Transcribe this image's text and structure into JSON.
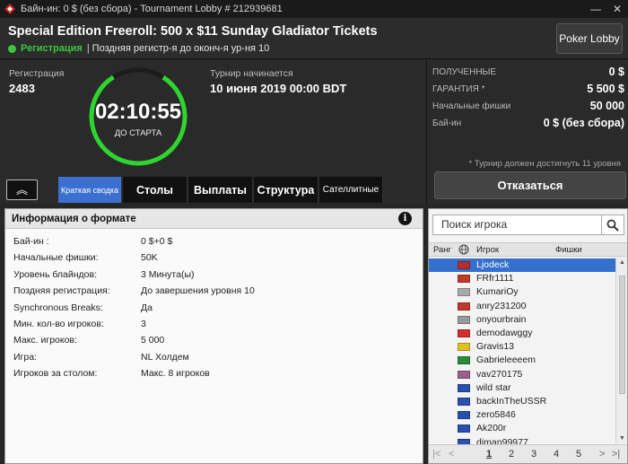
{
  "window": {
    "title": "Байн-ин: 0 $ (без сбора) - Tournament Lobby # 212939681",
    "btn_min": "—",
    "btn_close": "✕"
  },
  "header": {
    "tournament_name": "Special Edition Freeroll: 500 x $11 Sunday Gladiator Tickets",
    "status": "Регистрация",
    "status_sep": "|",
    "status_note": "Поздняя регистр-я до оконч-я ур-ня 10",
    "poker_lobby_btn": "Poker Lobby"
  },
  "info": {
    "reg_label": "Регистрация",
    "reg_value": "2483",
    "timer": "02:10:55",
    "timer_sub": "ДО СТАРТА",
    "start_label": "Турнир начинается",
    "start_value": "10 июня 2019  00:00 BDT",
    "timer_progress": 0.82
  },
  "summary": {
    "received_label": "ПОЛУЧЕННЫЕ",
    "received_value": "0 $",
    "guarantee_label": "ГАРАНТИЯ *",
    "guarantee_value": "5 500 $",
    "chips_label": "Начальные фишки",
    "chips_value": "50 000",
    "buyin_label": "Бай-ин",
    "buyin_value": "0 $ (без сбора)",
    "note": "* Турнир должен достигнуть 11 уровня",
    "unregister_btn": "Отказаться"
  },
  "tabs": {
    "collapse": "︽",
    "summary": "Краткая сводка",
    "tables": "Столы",
    "payouts": "Выплаты",
    "structure": "Структура",
    "satellites": "Сателлитные"
  },
  "format": {
    "title": "Информация о формате",
    "info_icon": "i",
    "rows": [
      {
        "k": "Бай-ин :",
        "v": "0 $+0 $"
      },
      {
        "k": "Начальные фишки:",
        "v": "50K"
      },
      {
        "k": "Уровень блайндов:",
        "v": "3 Минута(ы)"
      },
      {
        "k": "Поздняя регистрация:",
        "v": "До завершения уровня 10"
      },
      {
        "k": "Synchronous Breaks:",
        "v": "Да"
      },
      {
        "k": "Мин. кол-во игроков:",
        "v": "3"
      },
      {
        "k": "Макс. игроков:",
        "v": "5 000"
      },
      {
        "k": "Игра:",
        "v": "NL Холдем"
      },
      {
        "k": "Игроков за столом:",
        "v": "Макс. 8 игроков"
      }
    ]
  },
  "players": {
    "search_placeholder": "Поиск игрока",
    "col_rank": "Ранг",
    "col_player": "Игрок",
    "col_chips": "Фишки",
    "list": [
      {
        "name": "Ljodeck",
        "flag": "#b03030"
      },
      {
        "name": "FRfr1111",
        "flag": "#c0392b"
      },
      {
        "name": "KumariOy",
        "flag": "#aaaaaa"
      },
      {
        "name": "anry231200",
        "flag": "#c0392b"
      },
      {
        "name": "onyourbrain",
        "flag": "#9a9a9a"
      },
      {
        "name": "demodawggy",
        "flag": "#d03030"
      },
      {
        "name": "Gravis13",
        "flag": "#e0c020"
      },
      {
        "name": "Gabrieleeeem",
        "flag": "#2a8a3a"
      },
      {
        "name": "vav270175",
        "flag": "#9a6090"
      },
      {
        "name": "wild star",
        "flag": "#2850b0"
      },
      {
        "name": "backInTheUSSR",
        "flag": "#2850b0"
      },
      {
        "name": "zero5846",
        "flag": "#2850b0"
      },
      {
        "name": "Ak200r",
        "flag": "#2850b0"
      },
      {
        "name": "diman99977",
        "flag": "#2850b0"
      }
    ],
    "pages": [
      "1",
      "2",
      "3",
      "4",
      "5"
    ],
    "current_page": "1"
  },
  "colors": {
    "accent_blue": "#3b6fd0",
    "status_green": "#3ec63e"
  }
}
